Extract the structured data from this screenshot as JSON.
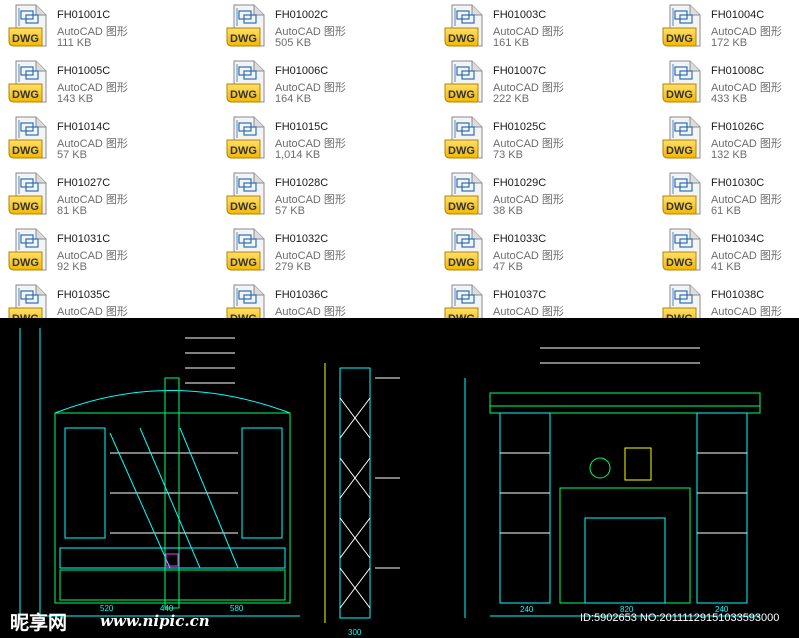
{
  "files": [
    {
      "name": "FH01001C",
      "type": "AutoCAD 图形",
      "size": "111 KB",
      "icon": "dwg-file-icon"
    },
    {
      "name": "FH01002C",
      "type": "AutoCAD 图形",
      "size": "505 KB",
      "icon": "dwg-file-icon"
    },
    {
      "name": "FH01003C",
      "type": "AutoCAD 图形",
      "size": "161 KB",
      "icon": "dwg-file-icon"
    },
    {
      "name": "FH01004C",
      "type": "AutoCAD 图形",
      "size": "172 KB",
      "icon": "dwg-file-icon"
    },
    {
      "name": "FH01005C",
      "type": "AutoCAD 图形",
      "size": "143 KB",
      "icon": "dwg-file-icon"
    },
    {
      "name": "FH01006C",
      "type": "AutoCAD 图形",
      "size": "164 KB",
      "icon": "dwg-file-icon"
    },
    {
      "name": "FH01007C",
      "type": "AutoCAD 图形",
      "size": "222 KB",
      "icon": "dwg-file-icon"
    },
    {
      "name": "FH01008C",
      "type": "AutoCAD 图形",
      "size": "433 KB",
      "icon": "dwg-file-icon"
    },
    {
      "name": "FH01014C",
      "type": "AutoCAD 图形",
      "size": "57 KB",
      "icon": "dwg-file-icon"
    },
    {
      "name": "FH01015C",
      "type": "AutoCAD 图形",
      "size": "1,014 KB",
      "icon": "dwg-file-icon"
    },
    {
      "name": "FH01025C",
      "type": "AutoCAD 图形",
      "size": "73 KB",
      "icon": "dwg-file-icon"
    },
    {
      "name": "FH01026C",
      "type": "AutoCAD 图形",
      "size": "132 KB",
      "icon": "dwg-file-icon"
    },
    {
      "name": "FH01027C",
      "type": "AutoCAD 图形",
      "size": "81 KB",
      "icon": "dwg-file-icon"
    },
    {
      "name": "FH01028C",
      "type": "AutoCAD 图形",
      "size": "57 KB",
      "icon": "dwg-file-icon"
    },
    {
      "name": "FH01029C",
      "type": "AutoCAD 图形",
      "size": "38 KB",
      "icon": "dwg-file-icon"
    },
    {
      "name": "FH01030C",
      "type": "AutoCAD 图形",
      "size": "61 KB",
      "icon": "dwg-file-icon"
    },
    {
      "name": "FH01031C",
      "type": "AutoCAD 图形",
      "size": "92 KB",
      "icon": "dwg-file-icon"
    },
    {
      "name": "FH01032C",
      "type": "AutoCAD 图形",
      "size": "279 KB",
      "icon": "dwg-file-icon"
    },
    {
      "name": "FH01033C",
      "type": "AutoCAD 图形",
      "size": "47 KB",
      "icon": "dwg-file-icon"
    },
    {
      "name": "FH01034C",
      "type": "AutoCAD 图形",
      "size": "41 KB",
      "icon": "dwg-file-icon"
    },
    {
      "name": "FH01035C",
      "type": "AutoCAD 图形",
      "size": "",
      "icon": "dwg-file-icon"
    },
    {
      "name": "FH01036C",
      "type": "AutoCAD 图形",
      "size": "",
      "icon": "dwg-file-icon"
    },
    {
      "name": "FH01037C",
      "type": "AutoCAD 图形",
      "size": "",
      "icon": "dwg-file-icon"
    },
    {
      "name": "FH01038C",
      "type": "AutoCAD 图形",
      "size": "",
      "icon": "dwg-file-icon"
    }
  ],
  "icon_label": "DWG",
  "colors": {
    "icon_gold": "#f2b705",
    "icon_gold_light": "#ffe066",
    "icon_blue": "#2b6fb6",
    "cad_background": "#000000",
    "cad_cyan": "#00ffff",
    "cad_green": "#00ff66",
    "cad_white": "#ffffff",
    "cad_yellow": "#ffff00",
    "cad_magenta": "#ff33ff"
  },
  "cad": {
    "dims_left": [
      "520",
      "440",
      "580"
    ],
    "dims_right": [
      "240",
      "820",
      "240"
    ],
    "dim_section": "300"
  },
  "watermark": {
    "logo": "昵享网",
    "url": "www.nipic.cn",
    "id": "ID:5902653 NO:20111129151033593000"
  }
}
